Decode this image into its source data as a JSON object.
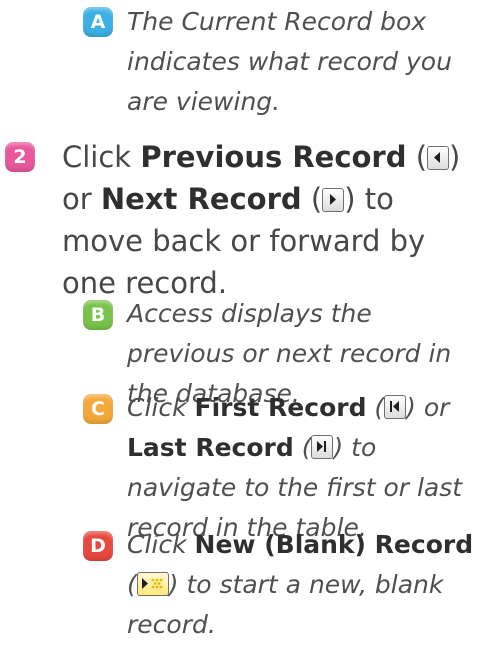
{
  "items": [
    {
      "badge": "A",
      "badge_color": "#3cb0e6",
      "parts": [
        "The Current Record box indicates what record you are viewing."
      ]
    },
    {
      "badge": "2",
      "badge_color": "#e9589a",
      "parts": [
        "Click ",
        "Previous Record",
        " (",
        ") or ",
        "Next Record",
        " (",
        ") to move back or forward by one record."
      ]
    },
    {
      "badge": "B",
      "badge_color": "#79c34a",
      "parts": [
        "Access displays the previous or next record in the database."
      ]
    },
    {
      "badge": "C",
      "badge_color": "#f2a93a",
      "parts": [
        "Click ",
        "First Record",
        " (",
        ") or ",
        "Last Record",
        " (",
        ") to navigate to the first or last record in the table."
      ]
    },
    {
      "badge": "D",
      "badge_color": "#e8473d",
      "parts": [
        "Click ",
        "New (Blank) Record",
        " (",
        ") to start a new, blank record."
      ]
    }
  ],
  "icons": {
    "previous": "previous-record-icon",
    "next": "next-record-icon",
    "first": "first-record-icon",
    "last": "last-record-icon",
    "new": "new-blank-record-icon"
  }
}
